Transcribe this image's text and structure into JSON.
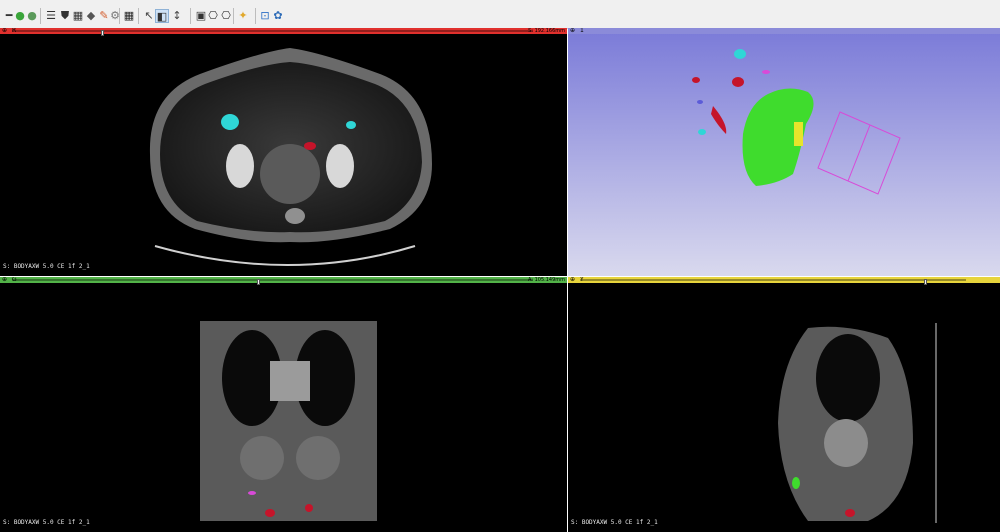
{
  "toolbar": {
    "icons": [
      "minus-icon",
      "green-back-icon",
      "forward-icon",
      "list-icon",
      "shield-icon",
      "data-cylinder-icon",
      "models-icon",
      "markups-icon",
      "transform-icon",
      "grid-layout-icon",
      "pointer-icon",
      "window-level-icon",
      "crosshair-icon",
      "capture-icon",
      "screenshot-icon",
      "extension-icon",
      "python-console-icon"
    ],
    "glyphs": {
      "minus": "━",
      "back": "●",
      "forward": "●",
      "list": "☰",
      "shield": "⛊",
      "data": "▦",
      "models": "◆",
      "markups": "✎",
      "transform": "⚙",
      "grid": "▦",
      "pointer": "↖",
      "window_level": "◧",
      "crosshair": "✦",
      "capture": "▣",
      "screenshot": "⎔",
      "extension": "⊡",
      "python": "✿"
    }
  },
  "views": {
    "red": {
      "name": "R",
      "offset": "S: 192.166mm",
      "bar_color": "#e0302d",
      "annotation": "S: BODYAXW  5.0  CE 1f  2_1"
    },
    "threed": {
      "name": "1",
      "bar_color": "#8b8bd9"
    },
    "green": {
      "name": "G",
      "offset": "A: 105.149mm",
      "bar_color": "#52b248",
      "annotation": "S: BODYAXW  5.0  CE 1f  2_1"
    },
    "yellow": {
      "name": "Y",
      "bar_color": "#e7d43c",
      "annotation": "S: BODYAXW  5.0  CE 1f  2_1"
    }
  },
  "colors": {
    "lesion_cyan": "#2fd6d6",
    "lesion_red": "#c5142a",
    "organ_green": "#3fdc2d",
    "lesion_yellow": "#e7e42b",
    "roi_magenta": "#d84ad8",
    "bg3d_top": "#7a7ad8",
    "bg3d_bottom": "#d9d9ee"
  }
}
